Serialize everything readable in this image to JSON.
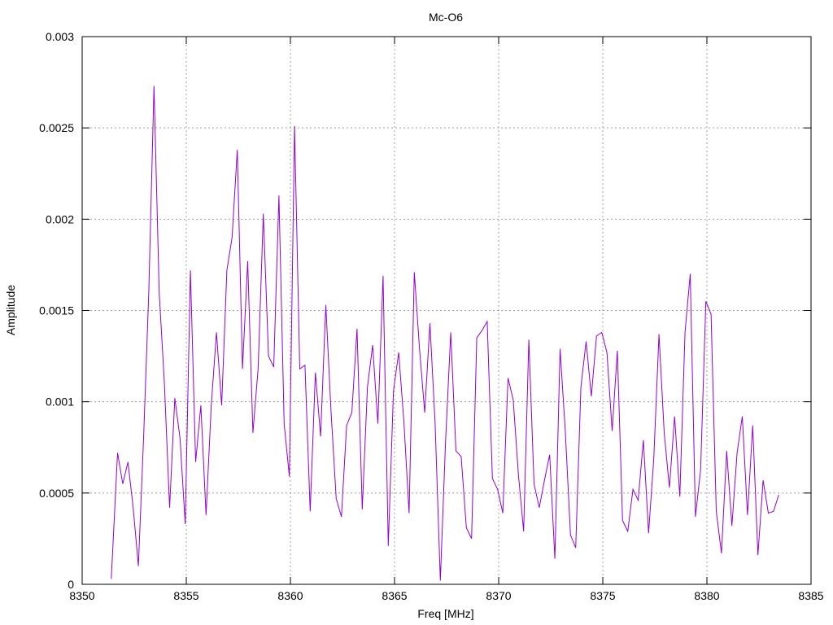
{
  "chart_data": {
    "type": "line",
    "title": "Mc-O6",
    "xlabel": "Freq [MHz]",
    "ylabel": "Amplitude",
    "xlim": [
      8350,
      8385
    ],
    "ylim": [
      0,
      0.003
    ],
    "xticks": [
      "8350",
      "8355",
      "8360",
      "8365",
      "8370",
      "8375",
      "8380",
      "8385"
    ],
    "yticks": [
      "0",
      "0.0005",
      "0.001",
      "0.0015",
      "0.002",
      "0.0025",
      "0.003"
    ],
    "grid": true,
    "line_color": "#9400d3",
    "series": [
      {
        "x": [
          8351.4,
          8351.7,
          8351.95,
          8352.2,
          8352.45,
          8352.7,
          8352.95,
          8353.2,
          8353.45,
          8353.7,
          8353.95,
          8354.2,
          8354.45,
          8354.7,
          8354.95,
          8355.2,
          8355.45,
          8355.7,
          8355.95,
          8356.2,
          8356.45,
          8356.7,
          8356.95,
          8357.2,
          8357.45,
          8357.7,
          8357.95,
          8358.2,
          8358.45,
          8358.7,
          8358.95,
          8359.2,
          8359.45,
          8359.7,
          8359.95,
          8360.2,
          8360.45,
          8360.7,
          8360.95,
          8361.2,
          8361.45,
          8361.7,
          8361.95,
          8362.2,
          8362.45,
          8362.7,
          8362.95,
          8363.2,
          8363.45,
          8363.7,
          8363.95,
          8364.2,
          8364.45,
          8364.7,
          8364.95,
          8365.2,
          8365.45,
          8365.7,
          8365.95,
          8366.2,
          8366.45,
          8366.7,
          8366.95,
          8367.2,
          8367.45,
          8367.7,
          8367.95,
          8368.2,
          8368.45,
          8368.7,
          8368.95,
          8369.2,
          8369.45,
          8369.7,
          8369.95,
          8370.2,
          8370.45,
          8370.7,
          8370.95,
          8371.2,
          8371.45,
          8371.7,
          8371.95,
          8372.2,
          8372.45,
          8372.7,
          8372.95,
          8373.2,
          8373.45,
          8373.7,
          8373.95,
          8374.2,
          8374.45,
          8374.7,
          8374.95,
          8375.2,
          8375.45,
          8375.7,
          8375.95,
          8376.2,
          8376.45,
          8376.7,
          8376.95,
          8377.2,
          8377.45,
          8377.7,
          8377.95,
          8378.2,
          8378.45,
          8378.7,
          8378.95,
          8379.2,
          8379.45,
          8379.7,
          8379.95,
          8380.2,
          8380.45,
          8380.7,
          8380.95,
          8381.2,
          8381.45,
          8381.7,
          8381.95,
          8382.2,
          8382.45,
          8382.7,
          8382.95,
          8383.2,
          8383.45
        ],
        "values": [
          3e-05,
          0.00072,
          0.00055,
          0.00067,
          0.00042,
          0.0001,
          0.0008,
          0.0016,
          0.00273,
          0.0016,
          0.0011,
          0.00042,
          0.00102,
          0.0008,
          0.00033,
          0.00172,
          0.00067,
          0.00098,
          0.00038,
          0.00098,
          0.00138,
          0.00098,
          0.00172,
          0.0019,
          0.00238,
          0.00118,
          0.00177,
          0.00083,
          0.00118,
          0.00203,
          0.00125,
          0.00119,
          0.00213,
          0.00088,
          0.00059,
          0.00251,
          0.00118,
          0.0012,
          0.0004,
          0.00116,
          0.00081,
          0.00153,
          0.00095,
          0.00047,
          0.00037,
          0.00087,
          0.00094,
          0.0014,
          0.00041,
          0.00108,
          0.00131,
          0.00088,
          0.00169,
          0.00021,
          0.00106,
          0.00127,
          0.00089,
          0.00039,
          0.00171,
          0.00129,
          0.00094,
          0.00143,
          0.00088,
          2e-05,
          0.00078,
          0.00138,
          0.00073,
          0.0007,
          0.00031,
          0.00025,
          0.00135,
          0.00139,
          0.00144,
          0.00058,
          0.00052,
          0.00039,
          0.00113,
          0.00101,
          0.0006,
          0.00029,
          0.00134,
          0.00055,
          0.00042,
          0.00057,
          0.00071,
          0.00014,
          0.00129,
          0.00084,
          0.00027,
          0.0002,
          0.00108,
          0.00133,
          0.00103,
          0.00136,
          0.00138,
          0.00127,
          0.00084,
          0.00128,
          0.00035,
          0.00029,
          0.00052,
          0.00046,
          0.00079,
          0.00028,
          0.00069,
          0.00137,
          0.00083,
          0.00053,
          0.00092,
          0.00048,
          0.00138,
          0.0017,
          0.00037,
          0.00063,
          0.00155,
          0.00148,
          0.0004,
          0.00017,
          0.00073,
          0.00032,
          0.00072,
          0.00092,
          0.00038,
          0.00087,
          0.00016,
          0.00057,
          0.00039,
          0.0004,
          0.00049
        ]
      }
    ]
  }
}
